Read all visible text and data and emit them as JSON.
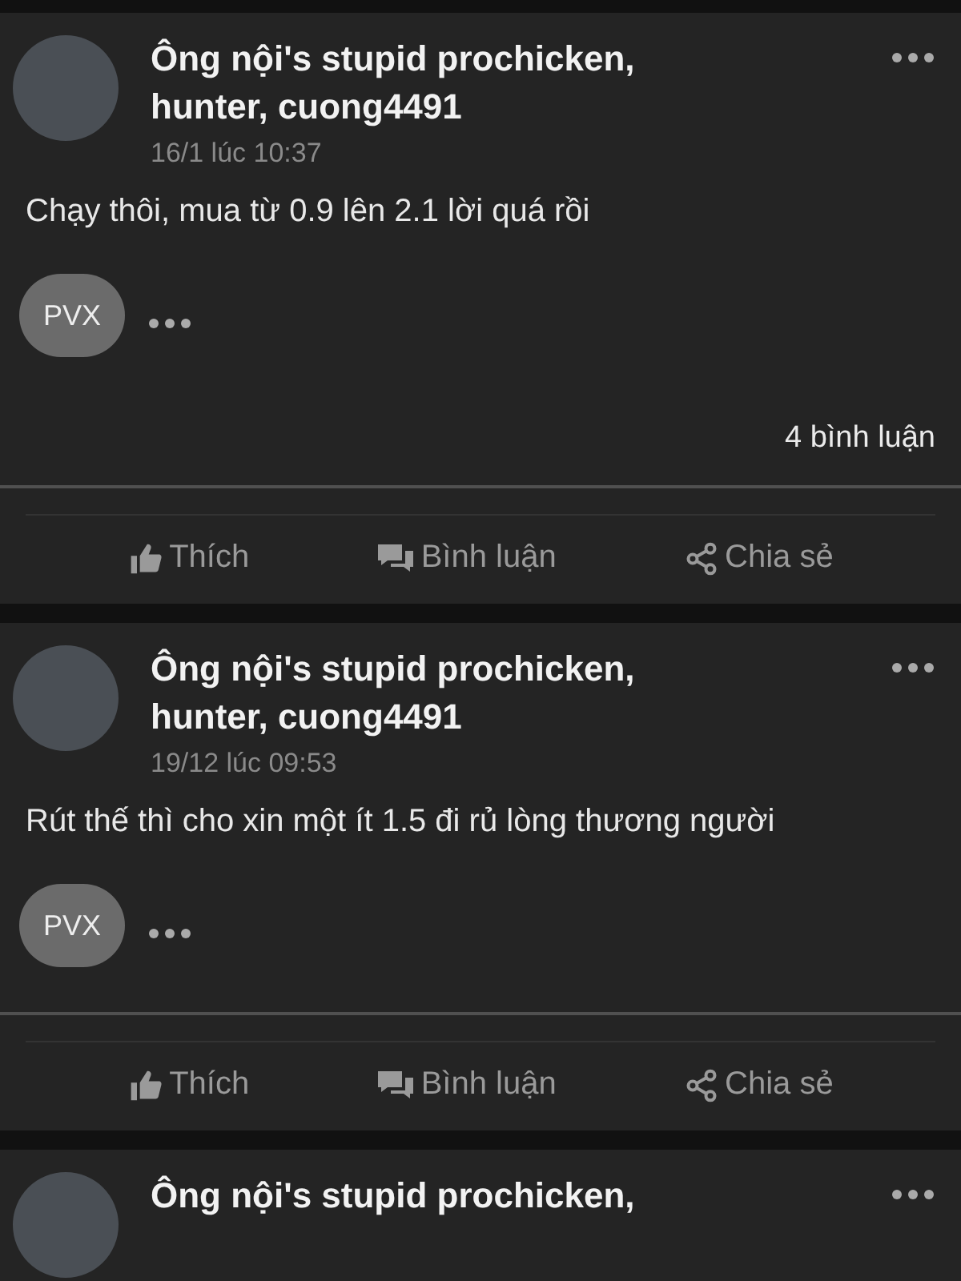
{
  "posts": [
    {
      "author": "Ông nội's stupid prochicken, hunter, cuong4491",
      "time": "16/1 lúc 10:37",
      "body": "Chạy thôi, mua từ 0.9 lên 2.1 lời quá rồi",
      "tag": "PVX",
      "comments": "4 bình luận",
      "actions": [
        {
          "kind": "like",
          "label": "Thích"
        },
        {
          "kind": "comment",
          "label": "Bình luận"
        },
        {
          "kind": "share",
          "label": "Chia sẻ"
        }
      ]
    },
    {
      "author": "Ông nội's stupid prochicken, hunter, cuong4491",
      "time": "19/12 lúc 09:53",
      "body": "Rút thế thì cho xin một ít 1.5 đi rủ lòng thương người",
      "tag": "PVX",
      "actions": [
        {
          "kind": "like",
          "label": "Thích"
        },
        {
          "kind": "comment",
          "label": "Bình luận"
        },
        {
          "kind": "share",
          "label": "Chia sẻ"
        }
      ]
    },
    {
      "author": "Ông nội's stupid prochicken,"
    }
  ]
}
